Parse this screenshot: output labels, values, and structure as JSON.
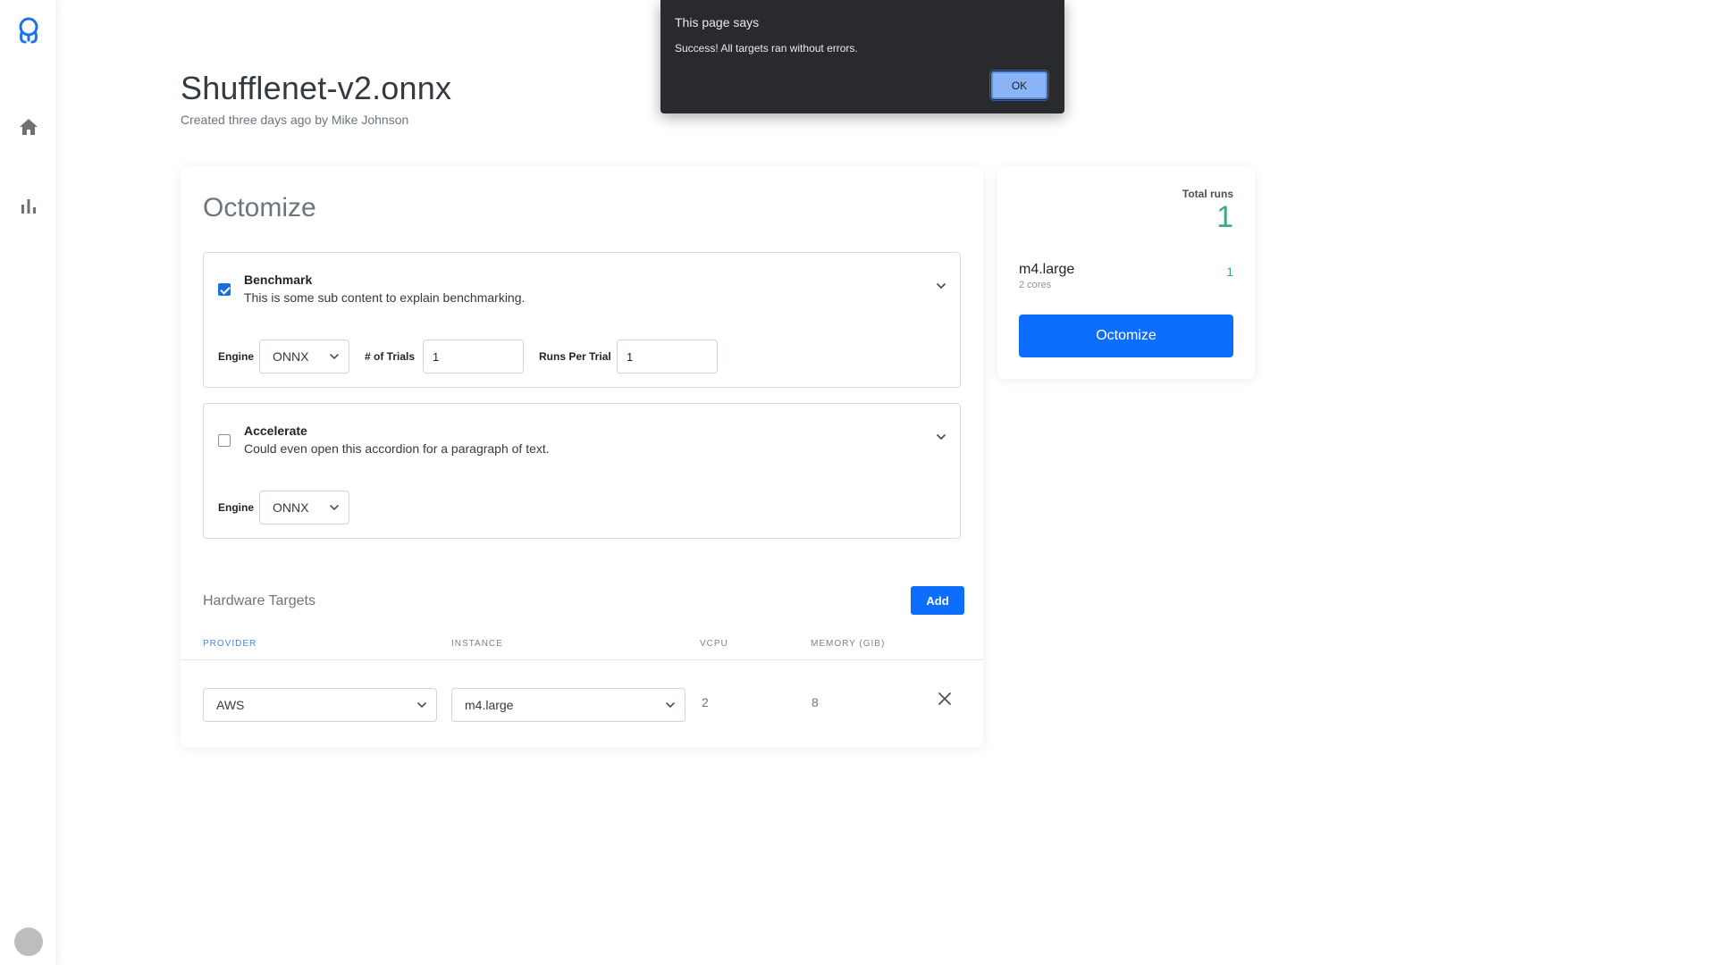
{
  "header": {
    "title": "Shufflenet-v2.onnx",
    "subtitle": "Created three days ago by Mike Johnson"
  },
  "card": {
    "title": "Octomize",
    "benchmark": {
      "checked": true,
      "heading": "Benchmark",
      "sub": "This is some sub content to explain benchmarking.",
      "engine_label": "Engine",
      "engine_value": "ONNX",
      "trials_label": "# of Trials",
      "trials_value": "1",
      "runs_label": "Runs Per Trial",
      "runs_value": "1"
    },
    "accelerate": {
      "checked": false,
      "heading": "Accelerate",
      "sub": "Could even open this accordion for a paragraph of text.",
      "engine_label": "Engine",
      "engine_value": "ONNX"
    },
    "hardware": {
      "title": "Hardware Targets",
      "add_label": "Add",
      "columns": [
        "Provider",
        "Instance",
        "VCPU",
        "Memory (GIB)"
      ],
      "rows": [
        {
          "provider": "AWS",
          "instance": "m4.large",
          "vcpu": "2",
          "memory": "8"
        }
      ]
    }
  },
  "summary": {
    "total_label": "Total runs",
    "total_value": "1",
    "instance_name": "m4.large",
    "instance_cores": "2 cores",
    "instance_count": "1",
    "button_label": "Octomize"
  },
  "dialog": {
    "title": "This page says",
    "message": "Success! All targets ran without errors.",
    "ok_label": "OK"
  },
  "colors": {
    "primary": "#0d6efd",
    "success": "#3bab7d",
    "dialog_bg": "#292a2d"
  }
}
